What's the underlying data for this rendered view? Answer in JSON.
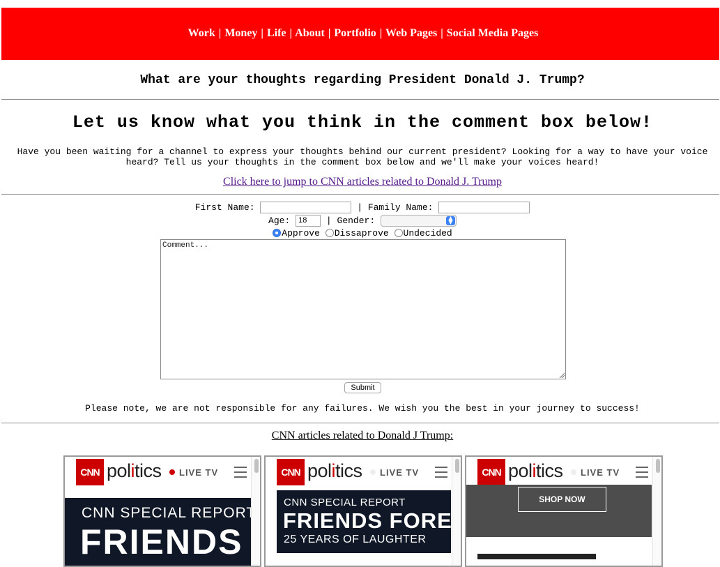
{
  "nav": {
    "items": [
      "Work",
      "Money",
      "Life",
      "About",
      "Portfolio",
      "Web Pages",
      "Social Media Pages"
    ],
    "separator": "|"
  },
  "main": {
    "question_heading": "What are your thoughts regarding President Donald J. Trump?",
    "cta_heading": "Let us know what you think in the comment box below!",
    "intro_text": "Have you been waiting for a channel to express your thoughts behind our current president? Looking for a way to have your voice heard? Tell us your thoughts in the comment box below and we'll make your voices heard!",
    "cnn_link": "Click here to jump to CNN articles related to Donald J. Trump"
  },
  "form": {
    "first_name_label": "First Name:",
    "first_name_value": "",
    "family_name_label": "Family Name:",
    "family_name_value": "",
    "separator": "|",
    "age_label": "Age:",
    "age_value": "18",
    "gender_label": "Gender:",
    "gender_value": "",
    "radio_options": [
      {
        "label": "Approve",
        "checked": true
      },
      {
        "label": "Dissaprove",
        "checked": false
      },
      {
        "label": "Undecided",
        "checked": false
      }
    ],
    "comment_placeholder": "Comment...",
    "submit_label": "Submit"
  },
  "disclaimer": "Please note, we are not responsible for any failures. We wish you the best in your journey to success!",
  "articles": {
    "title": "CNN articles related to Donald J Trump:",
    "cards": [
      {
        "logo": "CNN",
        "section": "politics",
        "live": "LIVE TV",
        "line1": "CNN SPECIAL REPORT",
        "line2": "FRIENDS"
      },
      {
        "logo": "CNN",
        "section": "politics",
        "live": "LIVE TV",
        "line1": "CNN SPECIAL REPORT",
        "line2": "FRIENDS FORE",
        "line3": "25 YEARS OF LAUGHTER"
      },
      {
        "logo": "CNN",
        "section": "politics",
        "live": "LIVE TV",
        "button": "SHOP NOW"
      }
    ]
  },
  "colors": {
    "nav_bg": "#ff0000",
    "link_visited": "#551a8b",
    "cnn_red": "#cc0000",
    "radio_checked": "#3b82f6"
  }
}
